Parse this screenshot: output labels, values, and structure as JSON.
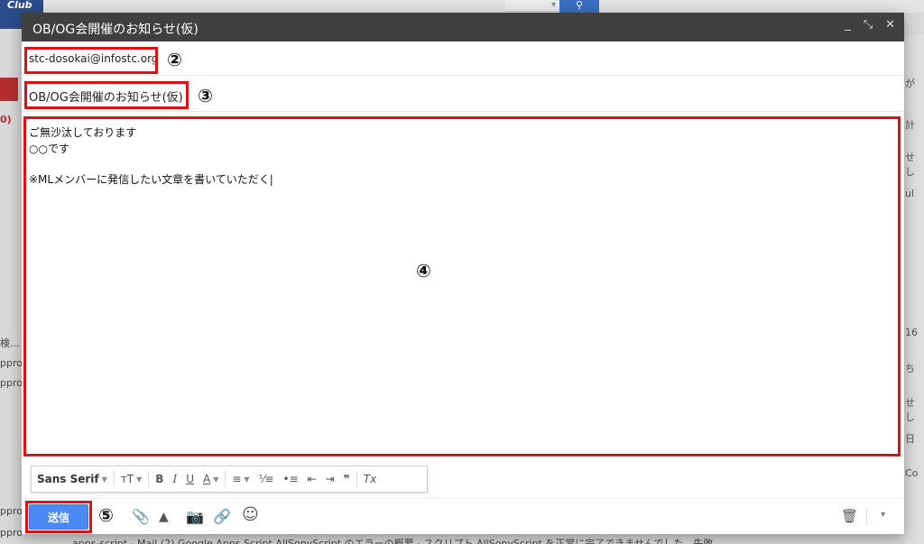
{
  "background": {
    "logo_text": "Club",
    "unread_count": "0)",
    "left_snippets": [
      "pprov",
      "pprov",
      "ppro",
      "ppro",
      "ppro"
    ],
    "right_snippets": [
      "が",
      "計",
      "せし",
      "ul",
      "16",
      "ち",
      "せし",
      "日",
      "Co"
    ],
    "bottom_row": "apps-script - Mail (2)          Google Apps Script AllSonyScript のエラーの概要 - スクリプト AllSonyScript を正常に完了できませんでした。失敗"
  },
  "compose": {
    "title": "OB/OG会開催のお知らせ(仮)",
    "title_icons": {
      "minimize": "_",
      "popout": "⤡",
      "close": "✕"
    },
    "to_value": "stc-dosokai@infostc.org",
    "subject_value": "OB/OG会開催のお知らせ(仮)",
    "body_lines": [
      "ご無沙汰しております",
      "○○です",
      "",
      "※MLメンバーに発信したい文章を書いていただく|"
    ],
    "markers": {
      "to": "②",
      "subject": "③",
      "body": "④",
      "send": "⑤"
    },
    "format_toolbar": {
      "font": "Sans Serif",
      "size": "ᴛT",
      "bold": "B",
      "italic": "I",
      "underline": "U",
      "text_color": "A",
      "align": "≡",
      "numbered_list": "⅟≡",
      "bulleted_list": "•≡",
      "indent_less": "⇤",
      "indent_more": "⇥",
      "quote": "❞",
      "remove_format": "Tx"
    },
    "send_label": "送信",
    "action_icons": {
      "attach": "📎",
      "drive": "▲",
      "photo": "📷",
      "link": "🔗",
      "emoji": "☺",
      "trash": "🗑",
      "more": "▾"
    }
  }
}
